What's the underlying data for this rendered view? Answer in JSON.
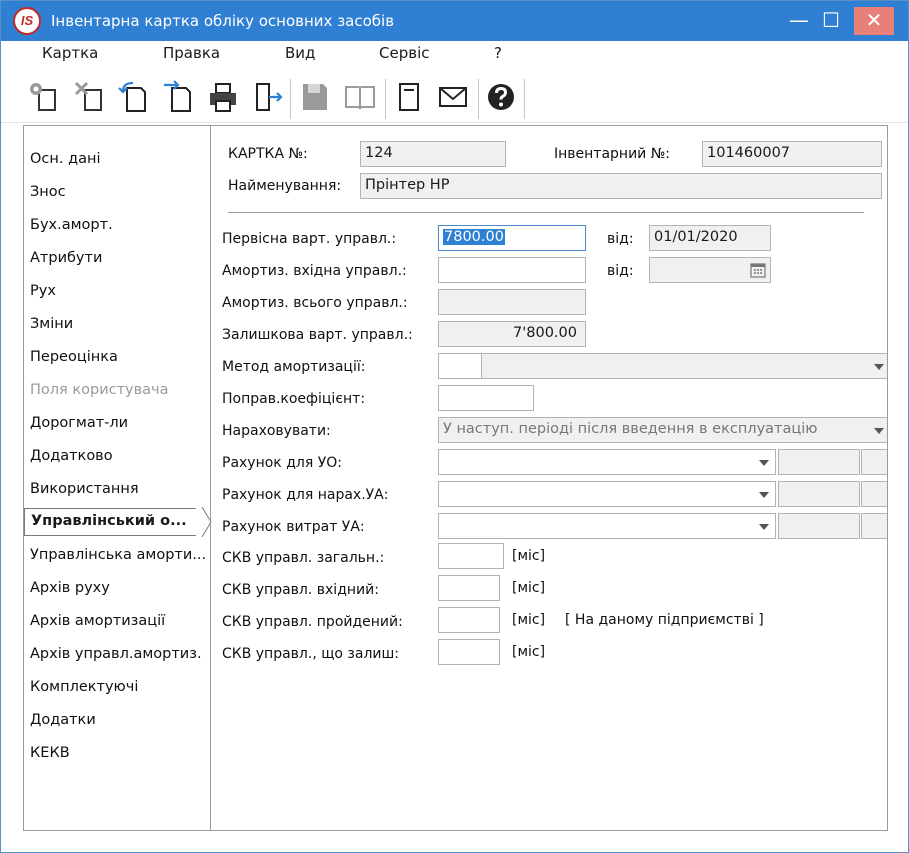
{
  "window": {
    "logo_text": "IS",
    "title": "Інвентарна картка обліку основних засобів",
    "min_glyph": "—",
    "max_glyph": "☐",
    "close_glyph": "✕"
  },
  "menu": [
    "Картка",
    "Правка",
    "Вид",
    "Сервіс",
    "?"
  ],
  "toolbar": {
    "icons": [
      "new-card-icon",
      "delete-card-icon",
      "import-icon",
      "export-icon",
      "print-icon",
      "exit-icon",
      "save-icon",
      "book-icon",
      "document-icon",
      "mail-icon",
      "help-icon"
    ]
  },
  "sidebar": {
    "items": [
      "Осн. дані",
      "Знос",
      "Бух.аморт.",
      "Атрибути",
      "Рух",
      "Зміни",
      "Переоцінка",
      "Поля користувача",
      "Дорогмат-ли",
      "Додатково",
      "Використання",
      "Управлінський о...",
      "Управлінська аморти...",
      "Архів руху",
      "Архів амортизації",
      "Архів управл.амортиз.",
      "Комплектуючі",
      "Додатки",
      "КЕКВ"
    ],
    "active_index": 11,
    "disabled_index": 7
  },
  "header": {
    "card_label": "КАРТКА №:",
    "card_value": "124",
    "inv_label": "Інвентарний №:",
    "inv_value": "101460007",
    "name_label": "Найменування:",
    "name_value": "Прінтер HP"
  },
  "form": {
    "initial_cost_label": "Первісна варт. управл.:",
    "initial_cost_value": "7800.00",
    "date_label_1": "від:",
    "date_value_1": "01/01/2020",
    "depr_in_label": "Амортиз. вхідна управл.:",
    "depr_in_value": "",
    "date_label_2": "від:",
    "date_value_2": "",
    "depr_total_label": "Амортиз. всього управл.:",
    "depr_total_value": "",
    "residual_label": "Залишкова варт. управл.:",
    "residual_value": "7'800.00",
    "method_label": "Метод амортизації:",
    "method_code": "",
    "method_value": "",
    "coef_label": "Поправ.коефіцієнт:",
    "coef_value": "",
    "accrue_label": "Нараховувати:",
    "accrue_value": "У наступ. періоді після введення в експлуатацію",
    "acc_uo_label": "Рахунок для УО:",
    "acc_ua_label": "Рахунок для нарах.УА:",
    "acc_exp_label": "Рахунок витрат УА:",
    "skv_total_label": "СКВ управл. загальн.:",
    "skv_in_label": "СКВ управл. вхідний:",
    "skv_passed_label": "СКВ управл. пройдений:",
    "skv_left_label": "СКВ управл., що залиш:",
    "unit": "[міс]",
    "enterprise_note": "[ На даному підприємстві ]"
  }
}
